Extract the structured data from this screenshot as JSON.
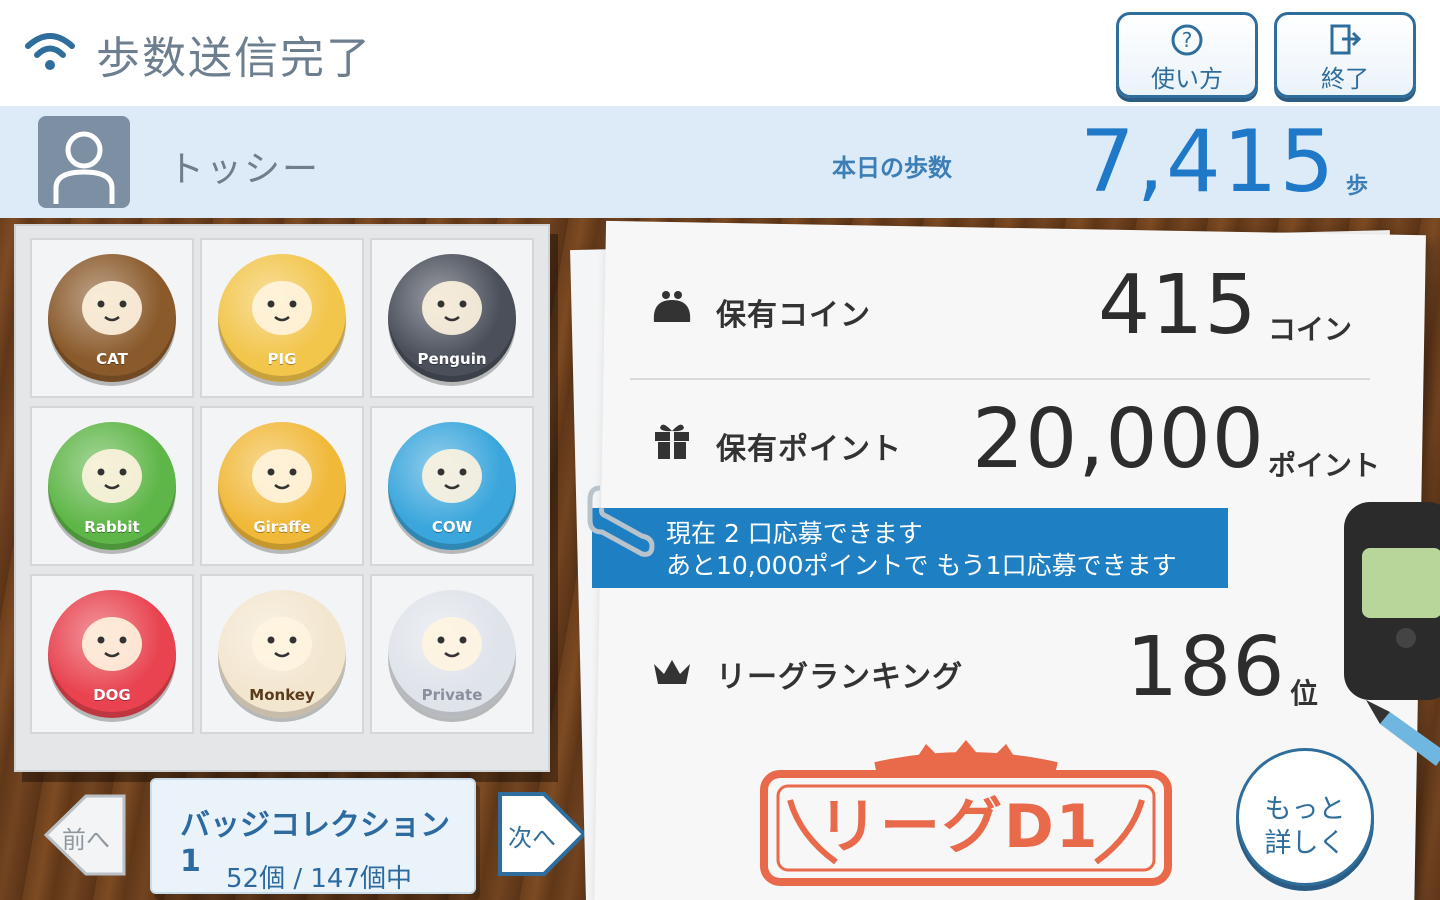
{
  "status": {
    "text": "歩数送信完了"
  },
  "buttons": {
    "help": "使い方",
    "exit": "終了"
  },
  "user": {
    "name": "トッシー",
    "steps_label": "本日の歩数",
    "steps_value": "7,415",
    "steps_unit": "歩"
  },
  "collection": {
    "badges": [
      {
        "name": "CAT",
        "color": "#8a5a2b"
      },
      {
        "name": "PIG",
        "color": "#f2c54b"
      },
      {
        "name": "Penguin",
        "color": "#4a4f5a"
      },
      {
        "name": "Rabbit",
        "color": "#5fb648"
      },
      {
        "name": "Giraffe",
        "color": "#f1b93a"
      },
      {
        "name": "COW",
        "color": "#3aa6dc"
      },
      {
        "name": "DOG",
        "color": "#e8434f"
      },
      {
        "name": "Monkey",
        "color": "#f3e6cf"
      },
      {
        "name": "Private",
        "color": "#dfe3ea"
      }
    ],
    "title": "バッジコレクション 1",
    "count": "52個 / 147個中",
    "prev_label": "前へ",
    "next_label": "次へ"
  },
  "stats": {
    "coins": {
      "label": "保有コイン",
      "value": "415",
      "unit": "コイン"
    },
    "points": {
      "label": "保有ポイント",
      "value": "20,000",
      "unit": "ポイント"
    },
    "ranking": {
      "label": "リーグランキング",
      "value": "186",
      "unit": "位"
    }
  },
  "notice": {
    "line1": "現在 2 口応募できます",
    "line2": "あと10,000ポイントで もう1口応募できます"
  },
  "league": {
    "label": "リーグD1"
  },
  "more_button": {
    "line1": "もっと",
    "line2": "詳しく"
  },
  "colors": {
    "accent": "#1f78c8",
    "header_band": "#dcebf7",
    "stamp": "#e86a4b",
    "notice": "#1f7fc3"
  }
}
